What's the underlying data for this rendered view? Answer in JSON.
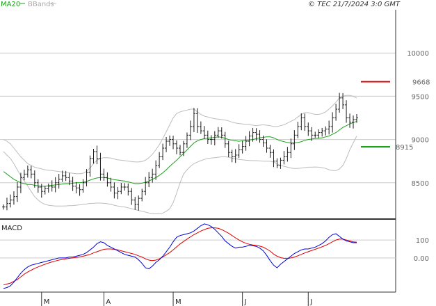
{
  "header": {
    "legend_ma": "MA20",
    "legend_bbands": "BBands",
    "copyright": "© TEC 21/7/2024 3:0 GMT"
  },
  "colors": {
    "ma": "#1aa01a",
    "bbands": "#bdbdbd",
    "bars": "#1a1a1a",
    "macd": "#0000dd",
    "signal": "#dd0000",
    "resistance": "#cc0000",
    "support": "#009900",
    "grid": "#cccccc",
    "frame": "#333333"
  },
  "chart_data": [
    {
      "type": "line",
      "panel": "price",
      "title": "",
      "ylim": [
        8080,
        10500
      ],
      "y_ticks": [
        "10000",
        "9500",
        "9000",
        "8500"
      ],
      "x_month_labels": [
        "M",
        "A",
        "M",
        "J",
        "J"
      ],
      "levels": {
        "resistance": {
          "label": "9668",
          "value": 9668
        },
        "support": {
          "label": "8915",
          "value": 8915
        }
      },
      "ohlc_close": [
        8220,
        8260,
        8300,
        8340,
        8450,
        8560,
        8600,
        8650,
        8600,
        8500,
        8450,
        8400,
        8430,
        8460,
        8450,
        8500,
        8540,
        8580,
        8560,
        8520,
        8460,
        8440,
        8420,
        8500,
        8620,
        8780,
        8860,
        8780,
        8600,
        8560,
        8500,
        8450,
        8380,
        8400,
        8450,
        8450,
        8400,
        8300,
        8250,
        8320,
        8400,
        8500,
        8560,
        8600,
        8700,
        8800,
        8900,
        8980,
        9000,
        8950,
        8900,
        8850,
        8950,
        9050,
        9150,
        9300,
        9150,
        9100,
        9050,
        9000,
        9000,
        9050,
        9100,
        9050,
        8950,
        8850,
        8800,
        8820,
        8880,
        8920,
        8980,
        9040,
        9080,
        9060,
        9000,
        8960,
        8900,
        8850,
        8750,
        8700,
        8760,
        8800,
        8850,
        8950,
        9050,
        9150,
        9250,
        9150,
        9100,
        9050,
        9050,
        9080,
        9100,
        9120,
        9150,
        9250,
        9350,
        9480,
        9400,
        9250,
        9200,
        9230,
        9250
      ],
      "ma20": [
        8630,
        8600,
        8570,
        8540,
        8520,
        8500,
        8490,
        8480,
        8480,
        8470,
        8465,
        8460,
        8460,
        8465,
        8470,
        8475,
        8480,
        8485,
        8490,
        8490,
        8495,
        8500,
        8500,
        8505,
        8515,
        8530,
        8545,
        8555,
        8560,
        8560,
        8555,
        8545,
        8535,
        8530,
        8525,
        8520,
        8510,
        8500,
        8490,
        8490,
        8495,
        8505,
        8520,
        8540,
        8560,
        8585,
        8615,
        8650,
        8690,
        8725,
        8760,
        8800,
        8840,
        8880,
        8920,
        8960,
        8985,
        9000,
        9010,
        9015,
        9020,
        9025,
        9030,
        9025,
        9015,
        9000,
        8990,
        8985,
        8980,
        8985,
        8990,
        8995,
        9000,
        9010,
        9020,
        9025,
        9030,
        9030,
        9020,
        9000,
        8985,
        8975,
        8965,
        8960,
        8960,
        8965,
        8975,
        8990,
        9000,
        9005,
        9010,
        9015,
        9020,
        9030,
        9040,
        9060,
        9080,
        9110,
        9140,
        9160,
        9180,
        9195,
        9210
      ],
      "bb_upper": [
        9000,
        8980,
        8950,
        8900,
        8850,
        8800,
        8760,
        8720,
        8700,
        8680,
        8670,
        8660,
        8650,
        8645,
        8640,
        8635,
        8630,
        8625,
        8620,
        8615,
        8610,
        8605,
        8605,
        8610,
        8630,
        8670,
        8720,
        8760,
        8780,
        8790,
        8790,
        8785,
        8775,
        8765,
        8760,
        8755,
        8750,
        8745,
        8740,
        8740,
        8745,
        8760,
        8790,
        8830,
        8880,
        8940,
        9010,
        9090,
        9170,
        9250,
        9300,
        9320,
        9330,
        9340,
        9350,
        9350,
        9320,
        9290,
        9270,
        9260,
        9250,
        9240,
        9235,
        9230,
        9225,
        9215,
        9200,
        9190,
        9185,
        9180,
        9175,
        9170,
        9165,
        9160,
        9165,
        9170,
        9165,
        9160,
        9150,
        9150,
        9160,
        9170,
        9190,
        9210,
        9230,
        9260,
        9290,
        9310,
        9310,
        9300,
        9290,
        9290,
        9300,
        9320,
        9350,
        9390,
        9430,
        9480,
        9500,
        9510,
        9510,
        9500,
        9480
      ],
      "bb_lower": [
        8860,
        8820,
        8780,
        8720,
        8650,
        8580,
        8520,
        8460,
        8400,
        8340,
        8300,
        8270,
        8250,
        8240,
        8235,
        8230,
        8230,
        8230,
        8232,
        8234,
        8236,
        8240,
        8245,
        8250,
        8255,
        8260,
        8262,
        8265,
        8265,
        8262,
        8258,
        8250,
        8240,
        8230,
        8225,
        8220,
        8210,
        8200,
        8190,
        8180,
        8170,
        8160,
        8150,
        8140,
        8140,
        8140,
        8150,
        8170,
        8200,
        8270,
        8380,
        8500,
        8600,
        8650,
        8690,
        8720,
        8740,
        8755,
        8770,
        8780,
        8785,
        8790,
        8795,
        8800,
        8800,
        8795,
        8785,
        8778,
        8770,
        8765,
        8760,
        8758,
        8755,
        8755,
        8752,
        8750,
        8750,
        8748,
        8740,
        8720,
        8700,
        8690,
        8680,
        8670,
        8665,
        8665,
        8670,
        8675,
        8680,
        8680,
        8682,
        8680,
        8675,
        8665,
        8650,
        8640,
        8640,
        8660,
        8700,
        8780,
        8880,
        8960,
        9040
      ]
    },
    {
      "type": "line",
      "panel": "macd",
      "title": "MACD",
      "ylim": [
        -190,
        205
      ],
      "y_ticks": [
        "100",
        "0.00"
      ],
      "series": [
        {
          "name": "",
          "values": [
            -170,
            -165,
            -155,
            -135,
            -110,
            -85,
            -65,
            -50,
            -40,
            -35,
            -30,
            -25,
            -20,
            -15,
            -10,
            -5,
            0,
            0,
            0,
            5,
            5,
            10,
            15,
            20,
            30,
            45,
            60,
            80,
            90,
            85,
            70,
            60,
            50,
            40,
            30,
            20,
            15,
            10,
            5,
            -10,
            -30,
            -55,
            -60,
            -45,
            -25,
            -10,
            10,
            35,
            60,
            90,
            115,
            125,
            130,
            135,
            140,
            150,
            165,
            180,
            190,
            185,
            175,
            160,
            140,
            120,
            95,
            80,
            65,
            55,
            60,
            60,
            65,
            70,
            68,
            65,
            55,
            40,
            15,
            -15,
            -40,
            -55,
            -35,
            -20,
            -5,
            10,
            25,
            35,
            45,
            50,
            50,
            55,
            60,
            70,
            80,
            95,
            115,
            130,
            135,
            120,
            105,
            95,
            90,
            85,
            85
          ]
        },
        {
          "name": "",
          "values": [
            -150,
            -145,
            -140,
            -130,
            -120,
            -105,
            -90,
            -78,
            -68,
            -58,
            -50,
            -42,
            -35,
            -28,
            -22,
            -17,
            -12,
            -8,
            -5,
            -2,
            0,
            3,
            6,
            10,
            15,
            20,
            28,
            35,
            42,
            48,
            50,
            50,
            48,
            45,
            40,
            35,
            30,
            25,
            20,
            12,
            5,
            -5,
            -12,
            -15,
            -12,
            -5,
            5,
            18,
            30,
            45,
            62,
            78,
            92,
            105,
            118,
            130,
            140,
            150,
            158,
            165,
            168,
            168,
            165,
            158,
            148,
            138,
            125,
            112,
            100,
            90,
            82,
            76,
            72,
            70,
            66,
            60,
            50,
            38,
            22,
            10,
            2,
            -2,
            -3,
            0,
            5,
            12,
            20,
            28,
            35,
            42,
            48,
            55,
            62,
            70,
            80,
            90,
            100,
            105,
            105,
            100,
            95,
            90,
            88
          ]
        }
      ]
    }
  ]
}
